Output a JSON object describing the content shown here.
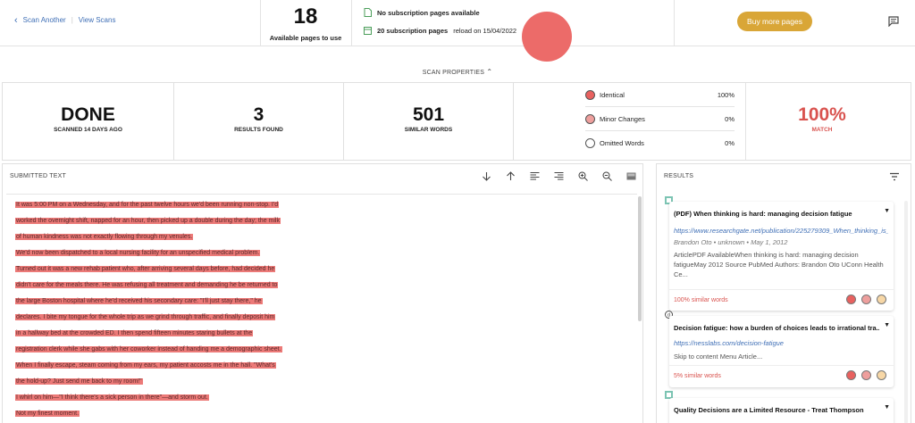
{
  "header": {
    "nav": {
      "scan_another": "Scan Another",
      "view_scans": "View Scans"
    },
    "available_pages_count": "18",
    "available_pages_label": "Available pages to use",
    "subscription_none": "No subscription pages available",
    "subscription_pages_bold": "20 subscription pages",
    "subscription_reload": "reload on 15/04/2022",
    "buy_button": "Buy more pages"
  },
  "scan_properties": {
    "title": "SCAN PROPERTIES",
    "status_value": "DONE",
    "status_label": "SCANNED 14 DAYS AGO",
    "results_value": "3",
    "results_label": "RESULTS FOUND",
    "words_value": "501",
    "words_label": "SIMILAR WORDS",
    "legend": [
      {
        "label": "Identical",
        "percent": "100%",
        "color": "#e8615f"
      },
      {
        "label": "Minor Changes",
        "percent": "0%",
        "color": "#ee9f9d"
      },
      {
        "label": "Omitted Words",
        "percent": "0%",
        "color": "#ffffff"
      }
    ],
    "match_value": "100%",
    "match_label": "MATCH",
    "accent_color": "#d9534f"
  },
  "submitted_text": {
    "title": "SUBMITTED TEXT",
    "tools": [
      "arrow-down-icon",
      "arrow-up-icon",
      "align-left-icon",
      "align-right-icon",
      "zoom-in-icon",
      "zoom-out-icon",
      "image-icon"
    ],
    "lines": [
      "It was 5:00 PM on a Wednesday, and for the past twelve hours we'd been running non-stop. I'd",
      "worked the overnight shift, napped for an hour, then picked up a double during the day; the milk",
      "of human kindness was not exactly flowing through my venules.",
      "We'd now been dispatched to a local nursing facility for an unspecified medical problem.",
      "Turned out it was a new rehab patient who, after arriving several days before, had decided he",
      "didn't care for the meals there. He was refusing all treatment and demanding he be returned to",
      "the large Boston hospital where he'd received his secondary care: \"I'll just stay there,\" he",
      "declares. I bite my tongue for the whole trip as we grind through traffic, and finally deposit him",
      "in a hallway bed at the crowded ED. I then spend fifteen minutes staring bullets at the",
      "registration clerk while she gabs with her coworker instead of handing me a demographic sheet.",
      "When I finally escape, steam coming from my ears, my patient accosts me in the hall. \"What's",
      "the hold-up? Just send me back to my room!\"",
      "I whirl on him—\"I think there's a sick person in there\"—and storm out.",
      "Not my finest moment."
    ]
  },
  "results": {
    "title": "RESULTS",
    "items": [
      {
        "title": "(PDF) When thinking is hard: managing decision fatigue",
        "url": "https://www.researchgate.net/publication/225279309_When_thinking_is_hard_managing_decision_fatigue",
        "meta": "Brandon Oto  •  unknown  •  May 1, 2012",
        "desc": "ArticlePDF AvailableWhen thinking is hard: managing decision fatigueMay 2012 Source PubMed Authors: Brandon Oto UConn Health Ce...",
        "similar": "100% similar words"
      },
      {
        "title": "Decision fatigue: how a burden of choices leads to irrational tra...",
        "url": "https://nesslabs.com/decision-fatigue",
        "meta": "",
        "desc": "Skip to content Menu Article...",
        "similar": "5% similar words"
      },
      {
        "title": "Quality Decisions are a Limited Resource - Treat Thompson",
        "url": "",
        "meta": "",
        "desc": "",
        "similar": ""
      }
    ]
  }
}
